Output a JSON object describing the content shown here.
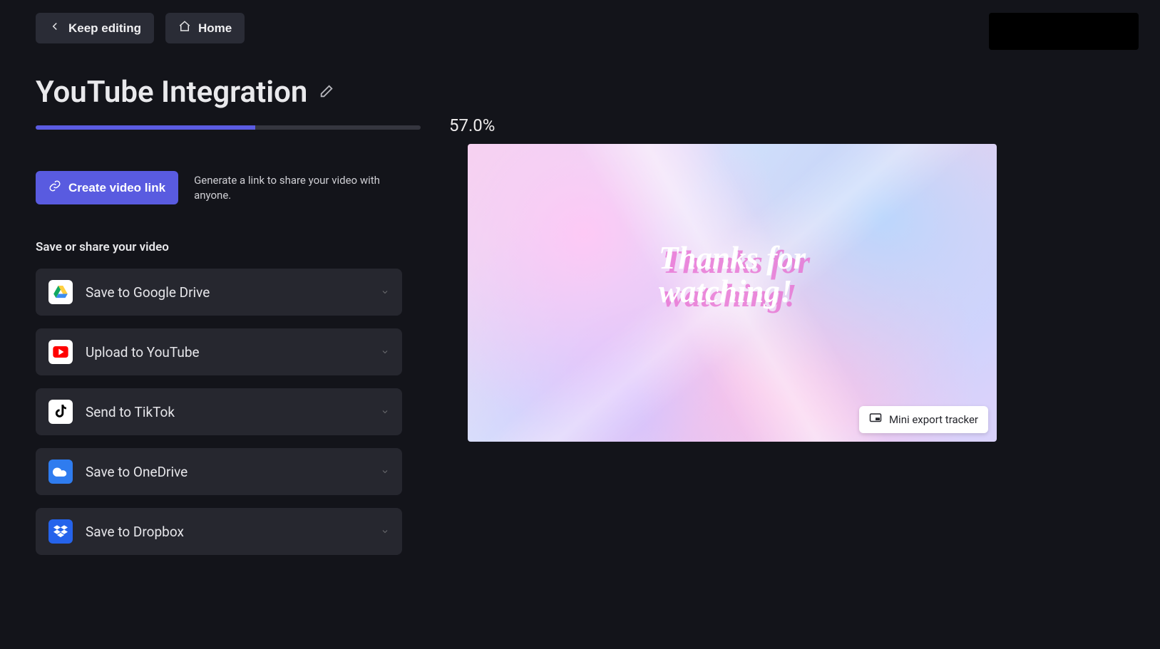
{
  "topbar": {
    "keep_editing": "Keep editing",
    "home": "Home"
  },
  "title": "YouTube Integration",
  "progress": {
    "percent": 57.0,
    "label": "57.0%"
  },
  "create_link": {
    "button": "Create video link",
    "description": "Generate a link to share your video with anyone."
  },
  "share_section_label": "Save or share your video",
  "share_options": [
    {
      "id": "gdrive",
      "label": "Save to Google Drive"
    },
    {
      "id": "youtube",
      "label": "Upload to YouTube"
    },
    {
      "id": "tiktok",
      "label": "Send to TikTok"
    },
    {
      "id": "onedrive",
      "label": "Save to OneDrive"
    },
    {
      "id": "dropbox",
      "label": "Save to Dropbox"
    }
  ],
  "preview": {
    "text": "Thanks for\nwatching!",
    "mini_tracker": "Mini export tracker"
  }
}
